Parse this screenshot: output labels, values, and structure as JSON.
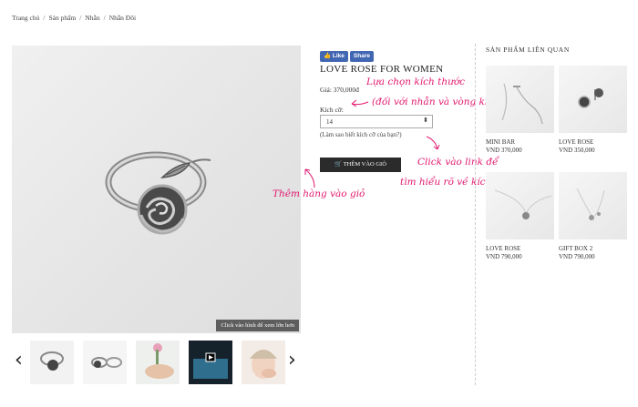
{
  "breadcrumb": [
    "Trang chủ",
    "Sản phẩm",
    "Nhẫn",
    "Nhẫn Đôi"
  ],
  "gallery": {
    "zoom_hint": "Click vào hình để xem lớn hơn",
    "prev_icon": "‹",
    "next_icon": "›",
    "thumbnails": 5
  },
  "social": {
    "like_label": "Like",
    "share_label": "Share"
  },
  "product": {
    "title": "LOVE ROSE FOR WOMEN",
    "price_label": "Giá:",
    "price": "370,000đ",
    "size_label": "Kích cỡ:",
    "size_value": "14",
    "size_help": "(Làm sao biết kích cỡ của bạn?)",
    "cart_label": "THÊM VÀO GIỎ"
  },
  "annotations": {
    "size_select_line1": "Lựa chọn kích thước",
    "size_select_line2": "(đối với nhẫn và vòng kiềng)",
    "size_help_line1": "Click vào link để",
    "size_help_line2": "tìm hiểu rõ về kích thước",
    "cart": "Thêm hàng vào giỏ"
  },
  "related": {
    "title": "SẢN PHẨM LIÊN QUAN",
    "items": [
      {
        "name": "MINI BAR",
        "price": "VND 370,000"
      },
      {
        "name": "LOVE ROSE",
        "price": "VND 350,000"
      },
      {
        "name": "LOVE ROSE",
        "price": "VND 790,000"
      },
      {
        "name": "GIFT BOX 2",
        "price": "VND 790,000"
      }
    ]
  },
  "colors": {
    "annotation": "#e2166d",
    "facebook": "#4267b2",
    "button": "#2b2b2b"
  }
}
